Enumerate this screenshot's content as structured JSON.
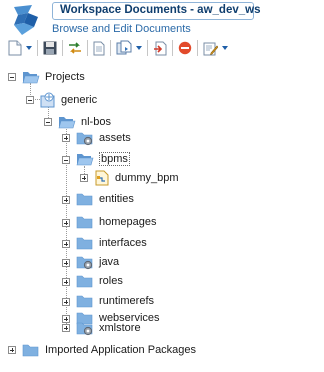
{
  "header": {
    "title": "Workspace Documents - aw_dev_ws",
    "subtitle": "Browse and Edit Documents",
    "logo_icon": "app-logo-icon"
  },
  "toolbar": {
    "buttons": [
      {
        "name": "new-document-button",
        "icon": "new-document-icon",
        "dropdown": true
      },
      {
        "name": "save-button",
        "icon": "save-icon"
      },
      {
        "name": "sync-button",
        "icon": "sync-arrows-icon"
      },
      {
        "name": "view-document-button",
        "icon": "document-icon"
      },
      {
        "name": "copy-button",
        "icon": "copy-icon",
        "dropdown": true
      },
      {
        "name": "export-button",
        "icon": "export-icon"
      },
      {
        "name": "delete-button",
        "icon": "delete-icon"
      },
      {
        "name": "edit-button",
        "icon": "edit-icon",
        "dropdown": true
      }
    ]
  },
  "tree": {
    "projects": "Projects",
    "generic": "generic",
    "nlbos": "nl-bos",
    "assets": "assets",
    "bpms": "bpms",
    "dummy_bpm": "dummy_bpm",
    "entities": "entities",
    "homepages": "homepages",
    "interfaces": "interfaces",
    "java": "java",
    "roles": "roles",
    "runtimerefs": "runtimerefs",
    "webservices": "webservices",
    "xmlstore": "xmlstore",
    "imported": "Imported Application Packages"
  },
  "colors": {
    "title_text": "#0f3e6e",
    "subtitle_text": "#2b6aa8",
    "folder": "#7fb0e0",
    "accent": "#1f5fa8"
  }
}
